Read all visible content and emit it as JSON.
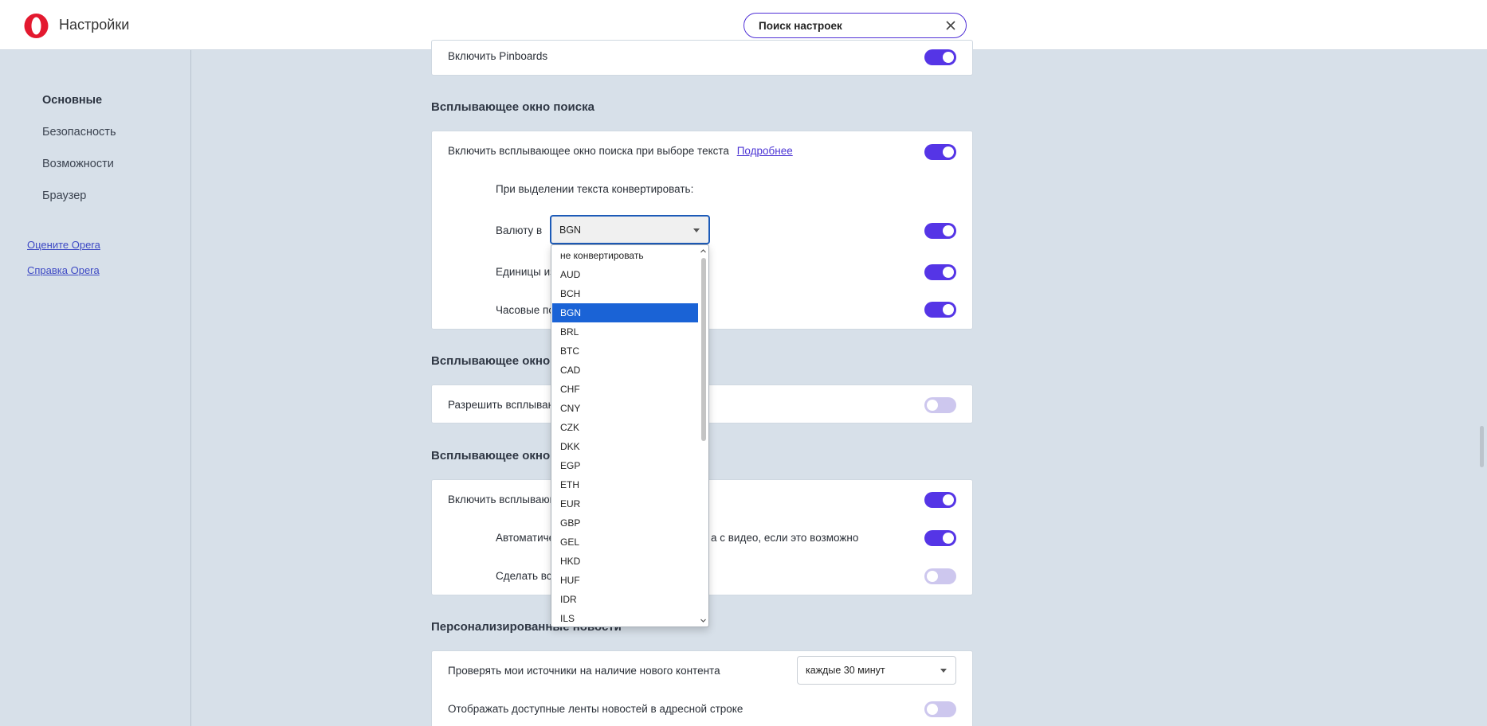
{
  "header": {
    "title": "Настройки",
    "search_placeholder": "Поиск настроек"
  },
  "sidebar": {
    "items": [
      {
        "label": "Основные",
        "active": true
      },
      {
        "label": "Безопасность",
        "active": false
      },
      {
        "label": "Возможности",
        "active": false
      },
      {
        "label": "Браузер",
        "active": false
      }
    ],
    "links": [
      {
        "label": "Оцените Opera"
      },
      {
        "label": "Справка Opera"
      }
    ]
  },
  "pinboards": {
    "label": "Включить Pinboards",
    "enabled": true
  },
  "search_popup": {
    "title": "Всплывающее окно поиска",
    "enable_label": "Включить всплывающее окно поиска при выборе текста",
    "more_link": "Подробнее",
    "convert_heading": "При выделении текста конвертировать:",
    "currency_label": "Валюту в",
    "currency_value": "BGN",
    "units_label": "Единицы из",
    "timezones_label": "Часовые по"
  },
  "section2": {
    "title": "Всплывающее окно с",
    "allow_label": "Разрешить всплываю"
  },
  "section3": {
    "title": "Всплывающее окно с",
    "enable_label": "Включить всплывающ",
    "auto_label_start": "Автоматиче",
    "auto_label_end": "а с видео, если это возможно",
    "make_label": "Сделать всп"
  },
  "news": {
    "title": "Персонализированные новости",
    "check_label": "Проверять мои источники на наличие нового контента",
    "check_value": "каждые 30 минут",
    "feeds_label": "Отображать доступные ленты новостей в адресной строке"
  },
  "currency_options": [
    "не конвертировать",
    "AUD",
    "BCH",
    "BGN",
    "BRL",
    "BTC",
    "CAD",
    "CHF",
    "CNY",
    "CZK",
    "DKK",
    "EGP",
    "ETH",
    "EUR",
    "GBP",
    "GEL",
    "HKD",
    "HUF",
    "IDR",
    "ILS"
  ],
  "selected_currency": "BGN",
  "colors": {
    "accent": "#5535e6",
    "toggle_off": "#cdc7ee",
    "selected_option": "#1a63d6",
    "opera_red": "#e3192f"
  }
}
